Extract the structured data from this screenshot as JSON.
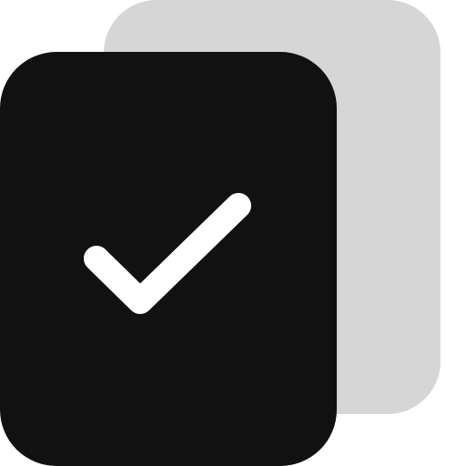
{
  "icon": {
    "name": "copy-check-icon",
    "back_card_color": "#d6d6d6",
    "front_card_color": "#111111",
    "check_color": "#ffffff",
    "background_color": "#ffffff"
  }
}
